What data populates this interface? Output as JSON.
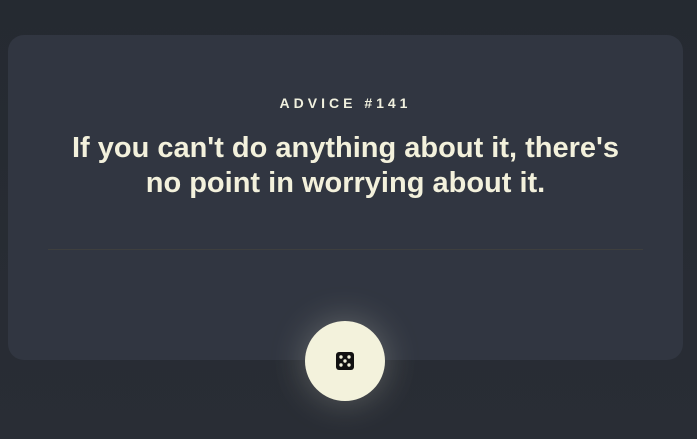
{
  "card": {
    "label": "ADVICE #141",
    "quote": "If you can't do anything about it, there's no point in worrying about it."
  },
  "actions": {
    "dice_icon": "dice-icon"
  },
  "colors": {
    "background": "#262a33",
    "card": "#313641",
    "text": "#f3f1dc",
    "button": "#f3f2dc"
  }
}
